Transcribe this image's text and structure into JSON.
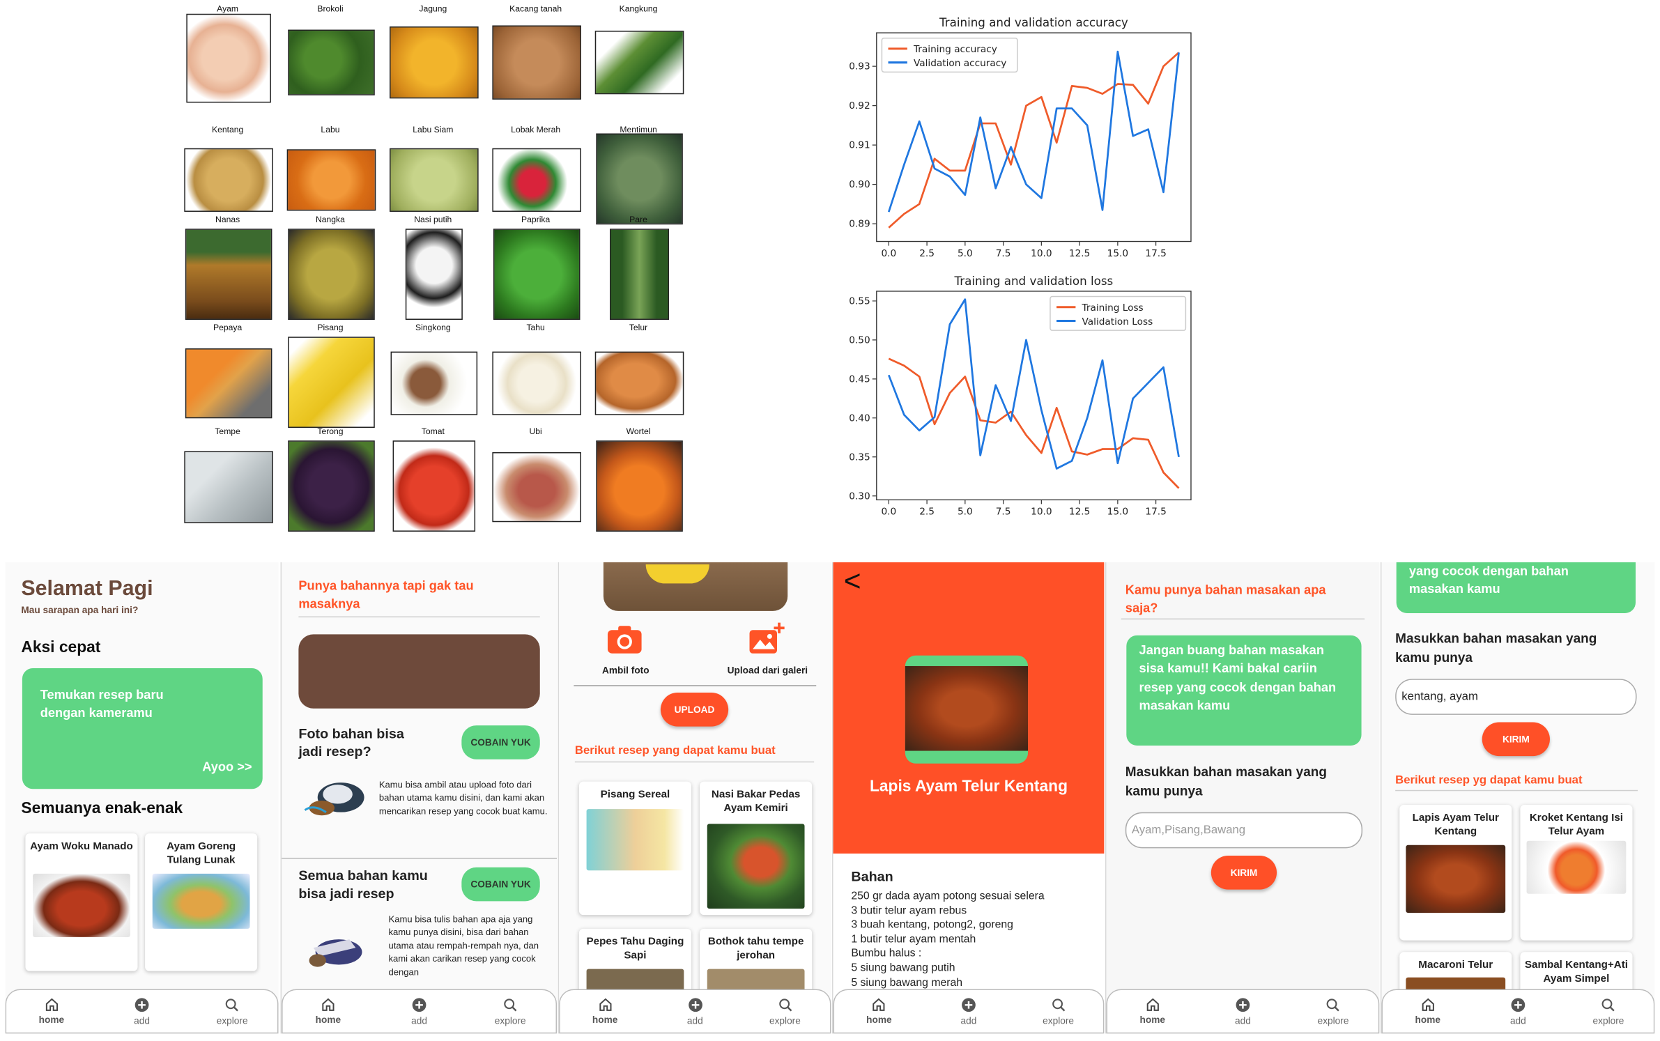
{
  "grid": {
    "items": [
      {
        "label": "Ayam"
      },
      {
        "label": "Brokoli"
      },
      {
        "label": "Jagung"
      },
      {
        "label": "Kacang tanah"
      },
      {
        "label": "Kangkung"
      },
      {
        "label": "Kentang"
      },
      {
        "label": "Labu"
      },
      {
        "label": "Labu Siam"
      },
      {
        "label": "Lobak Merah"
      },
      {
        "label": "Mentimun"
      },
      {
        "label": "Nanas"
      },
      {
        "label": "Nangka"
      },
      {
        "label": "Nasi putih"
      },
      {
        "label": "Paprika"
      },
      {
        "label": "Pare"
      },
      {
        "label": "Pepaya"
      },
      {
        "label": "Pisang"
      },
      {
        "label": "Singkong"
      },
      {
        "label": "Tahu"
      },
      {
        "label": "Telur"
      },
      {
        "label": "Tempe"
      },
      {
        "label": "Terong"
      },
      {
        "label": "Tomat"
      },
      {
        "label": "Ubi"
      },
      {
        "label": "Wortel"
      }
    ]
  },
  "chart_data": [
    {
      "type": "line",
      "title": "Training and validation accuracy",
      "xlim": [
        -0.8,
        19.8
      ],
      "ylim": [
        0.8855,
        0.9385
      ],
      "xticks": [
        0.0,
        2.5,
        5.0,
        7.5,
        10.0,
        12.5,
        15.0,
        17.5
      ],
      "xtick_labels": [
        "0.0",
        "2.5",
        "5.0",
        "7.5",
        "10.0",
        "12.5",
        "15.0",
        "17.5"
      ],
      "yticks": [
        0.89,
        0.9,
        0.91,
        0.92,
        0.93
      ],
      "ytick_labels": [
        "0.89",
        "0.90",
        "0.91",
        "0.92",
        "0.93"
      ],
      "legend": "upper left",
      "x": [
        0,
        1,
        2,
        3,
        4,
        5,
        6,
        7,
        8,
        9,
        10,
        11,
        12,
        13,
        14,
        15,
        16,
        17,
        18,
        19
      ],
      "series": [
        {
          "name": "Training accuracy",
          "color": "#ef5b2a",
          "values": [
            0.889,
            0.8925,
            0.895,
            0.9065,
            0.9035,
            0.9035,
            0.9155,
            0.9155,
            0.905,
            0.92,
            0.9222,
            0.9106,
            0.925,
            0.9245,
            0.923,
            0.9255,
            0.9253,
            0.9205,
            0.93,
            0.9335
          ]
        },
        {
          "name": "Validation accuracy",
          "color": "#1f77e0",
          "values": [
            0.893,
            0.905,
            0.916,
            0.904,
            0.902,
            0.8973,
            0.917,
            0.899,
            0.9095,
            0.9,
            0.8965,
            0.9193,
            0.9193,
            0.915,
            0.8935,
            0.9337,
            0.9123,
            0.914,
            0.898,
            0.9335
          ]
        }
      ]
    },
    {
      "type": "line",
      "title": "Training and validation loss",
      "xlim": [
        -0.8,
        19.8
      ],
      "ylim": [
        0.295,
        0.5625
      ],
      "xticks": [
        0.0,
        2.5,
        5.0,
        7.5,
        10.0,
        12.5,
        15.0,
        17.5
      ],
      "xtick_labels": [
        "0.0",
        "2.5",
        "5.0",
        "7.5",
        "10.0",
        "12.5",
        "15.0",
        "17.5"
      ],
      "yticks": [
        0.3,
        0.35,
        0.4,
        0.45,
        0.5,
        0.55
      ],
      "ytick_labels": [
        "0.30",
        "0.35",
        "0.40",
        "0.45",
        "0.50",
        "0.55"
      ],
      "legend": "upper right",
      "x": [
        0,
        1,
        2,
        3,
        4,
        5,
        6,
        7,
        8,
        9,
        10,
        11,
        12,
        13,
        14,
        15,
        16,
        17,
        18,
        19
      ],
      "series": [
        {
          "name": "Training Loss",
          "color": "#ef5b2a",
          "values": [
            0.476,
            0.467,
            0.453,
            0.392,
            0.432,
            0.453,
            0.397,
            0.394,
            0.408,
            0.378,
            0.355,
            0.413,
            0.357,
            0.353,
            0.36,
            0.36,
            0.374,
            0.372,
            0.33,
            0.31
          ]
        },
        {
          "name": "Validation Loss",
          "color": "#1f77e0",
          "values": [
            0.455,
            0.404,
            0.384,
            0.401,
            0.52,
            0.552,
            0.352,
            0.442,
            0.396,
            0.5,
            0.41,
            0.335,
            0.345,
            0.4,
            0.474,
            0.342,
            0.425,
            0.445,
            0.465,
            0.35
          ]
        }
      ]
    }
  ],
  "nav": {
    "home": "home",
    "add": "add",
    "explore": "explore"
  },
  "screen1": {
    "greeting": "Selamat Pagi",
    "subtitle": "Mau sarapan apa hari ini?",
    "quick_title": "Aksi cepat",
    "banner_text": "Temukan resep baru dengan kameramu",
    "banner_cta": "Ayoo >>",
    "section_title": "Semuanya enak-enak",
    "cards": [
      {
        "title": "Ayam Woku Manado"
      },
      {
        "title": "Ayam Goreng Tulang Lunak"
      }
    ]
  },
  "screen2": {
    "title": "Punya bahannya tapi gak tau masaknya",
    "feature1_title": "Foto bahan bisa jadi resep?",
    "feature1_button": "COBAIN YUK",
    "feature1_desc": "Kamu bisa ambil atau upload foto dari bahan utama kamu disini, dan kami akan mencarikan resep yang cocok buat kamu.",
    "feature2_title": "Semua bahan kamu bisa jadi resep",
    "feature2_button": "COBAIN YUK",
    "feature2_desc": "Kamu bisa tulis bahan apa aja yang kamu punya disini, bisa dari bahan utama atau rempah-rempah nya, dan kami akan carikan resep yang cocok dengan"
  },
  "screen3": {
    "camera_label": "Ambil foto",
    "gallery_label": "Upload dari galeri",
    "upload_button": "UPLOAD",
    "result_title": "Berikut resep yang dapat kamu buat",
    "cards": [
      {
        "title": "Pisang Sereal"
      },
      {
        "title": "Nasi Bakar Pedas Ayam Kemiri"
      },
      {
        "title": "Pepes Tahu Daging Sapi"
      },
      {
        "title": "Bothok tahu tempe jerohan"
      }
    ]
  },
  "screen4": {
    "back": "<",
    "recipe_title": "Lapis Ayam Telur Kentang",
    "section": "Bahan",
    "ingredients": [
      "250 gr dada ayam potong sesuai selera",
      "3 butir telur ayam rebus",
      "3 buah kentang, potong2, goreng",
      "1 butir telur ayam mentah",
      "Bumbu halus :",
      "5 siung bawang putih",
      "5 siung bawang merah"
    ]
  },
  "screen5": {
    "title": "Kamu punya bahan masakan apa saja?",
    "banner_text": "Jangan buang bahan masakan sisa kamu!! Kami bakal cariin resep yang cocok dengan bahan masakan kamu",
    "input_label": "Masukkan bahan masakan yang kamu punya",
    "input_placeholder": "Ayam,Pisang,Bawang",
    "submit": "KIRIM"
  },
  "screen6": {
    "banner_text": "yang cocok dengan bahan masakan kamu",
    "input_label": "Masukkan bahan masakan yang kamu punya",
    "input_value": "kentang, ayam",
    "submit": "KIRIM",
    "result_title": "Berikut resep yg dapat kamu buat",
    "cards": [
      {
        "title": "Lapis Ayam Telur Kentang"
      },
      {
        "title": "Kroket Kentang Isi Telur Ayam"
      },
      {
        "title": "Macaroni Telur"
      },
      {
        "title": "Sambal Kentang+Ati Ayam Simpel"
      }
    ]
  },
  "colors": {
    "accent_orange": "#ff5427",
    "accent_green": "#5fd584",
    "brown": "#6b4a3b"
  }
}
